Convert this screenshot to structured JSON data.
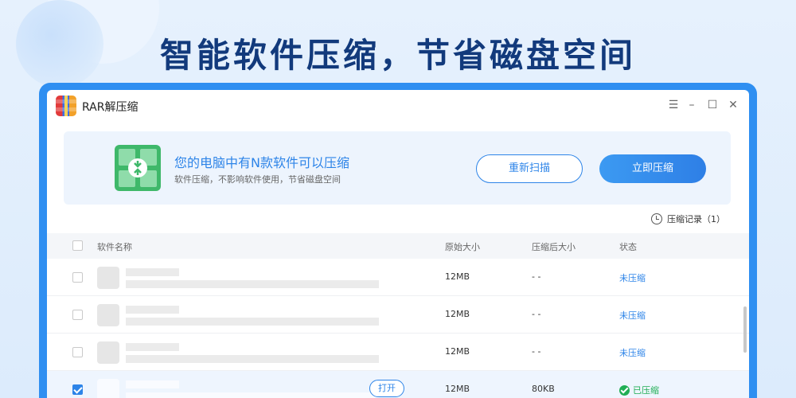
{
  "headline": "智能软件压缩，节省磁盘空间",
  "window": {
    "title": "RAR解压缩",
    "controls": {
      "menu": "☰",
      "minimize": "–",
      "maximize": "☐",
      "close": "✕"
    }
  },
  "banner": {
    "title": "您的电脑中有N款软件可以压缩",
    "subtitle": "软件压缩，不影响软件使用，节省磁盘空间",
    "rescan_label": "重新扫描",
    "compress_label": "立即压缩"
  },
  "history_label": "压缩记录（1）",
  "table": {
    "headers": {
      "name": "软件名称",
      "original": "原始大小",
      "compressed": "压缩后大小",
      "status": "状态"
    },
    "rows": [
      {
        "original": "12MB",
        "compressed": "- -",
        "status": "未压缩",
        "checked": false
      },
      {
        "original": "12MB",
        "compressed": "- -",
        "status": "未压缩",
        "checked": false
      },
      {
        "original": "12MB",
        "compressed": "- -",
        "status": "未压缩",
        "checked": false
      },
      {
        "original": "12MB",
        "compressed": "80KB",
        "status": "已压缩",
        "checked": true,
        "action": "打开"
      }
    ]
  },
  "colors": {
    "accent": "#2d84e8",
    "success": "#1fae54",
    "frame": "#2f8ff1"
  }
}
